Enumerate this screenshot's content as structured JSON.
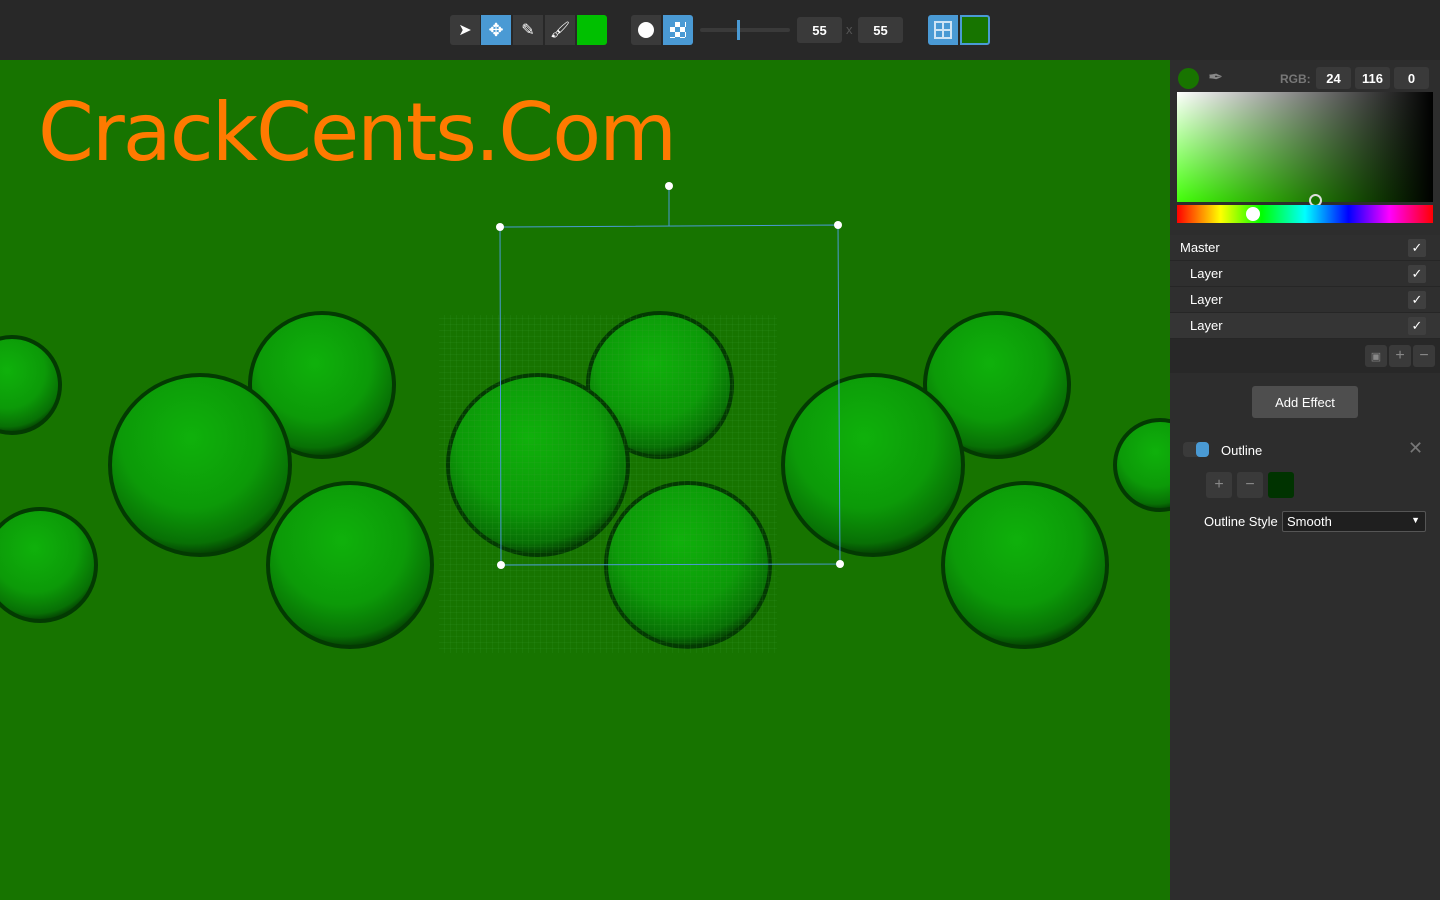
{
  "toolbar": {
    "tools": [
      "select-tool",
      "move-tool",
      "eraser-tool",
      "brush-tool"
    ],
    "active_tool": "move-tool",
    "primary_color": "#00c000",
    "brush_size": "55",
    "brush_size_y": "55",
    "size_separator": "x",
    "background_color": "#177400"
  },
  "canvas": {
    "background": "#177400",
    "watermark": "CrackCents.Com"
  },
  "color_picker": {
    "rgb_label": "RGB:",
    "r": "24",
    "g": "116",
    "b": "0",
    "current_color": "#187400"
  },
  "layers": {
    "items": [
      {
        "label": "Master",
        "visible": true
      },
      {
        "label": "Layer",
        "visible": true
      },
      {
        "label": "Layer",
        "visible": true
      },
      {
        "label": "Layer",
        "visible": true,
        "selected": true
      }
    ]
  },
  "effects": {
    "add_label": "Add Effect",
    "items": [
      {
        "label": "Outline",
        "enabled": true,
        "color": "#003300",
        "style_label": "Outline Style",
        "style_value": "Smooth"
      }
    ]
  }
}
